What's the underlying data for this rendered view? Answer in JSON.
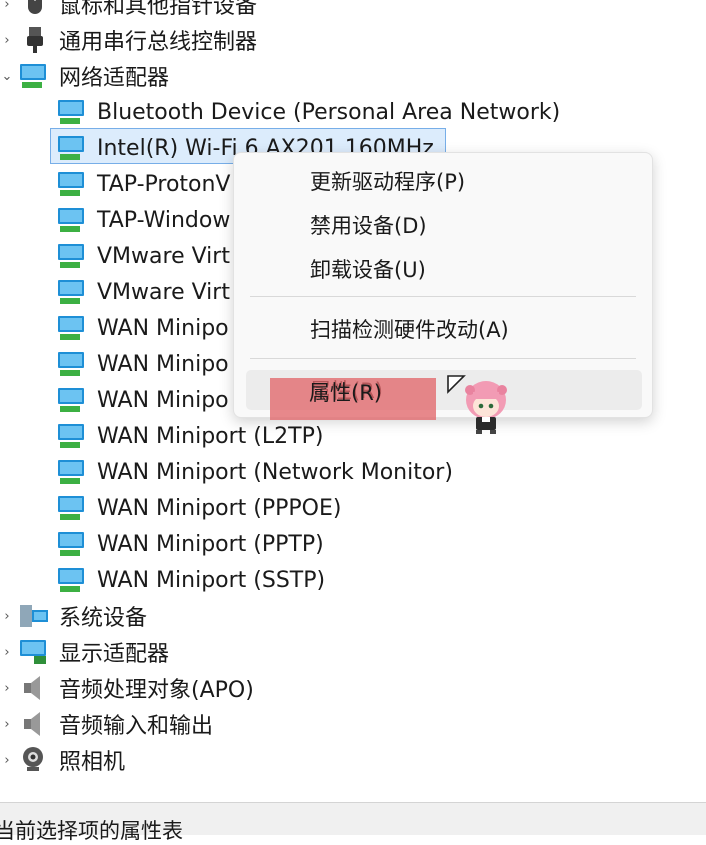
{
  "tree": {
    "categories_top": [
      {
        "label": "鼠标和其他指针设备",
        "icon": "mouse-icon"
      },
      {
        "label": "通用串行总线控制器",
        "icon": "usb-icon"
      },
      {
        "label": "网络适配器",
        "icon": "network-adapter-icon",
        "expanded": true
      }
    ],
    "network_adapters": [
      {
        "label": "Bluetooth Device (Personal Area Network)"
      },
      {
        "label": "Intel(R) Wi-Fi 6 AX201 160MHz",
        "selected": true
      },
      {
        "label": "TAP-ProtonV"
      },
      {
        "label": "TAP-Window"
      },
      {
        "label": "VMware Virt"
      },
      {
        "label": "VMware Virt"
      },
      {
        "label": "WAN Minipo"
      },
      {
        "label": "WAN Minipo"
      },
      {
        "label": "WAN Minipo"
      },
      {
        "label": "WAN Miniport (L2TP)"
      },
      {
        "label": "WAN Miniport (Network Monitor)"
      },
      {
        "label": "WAN Miniport (PPPOE)"
      },
      {
        "label": "WAN Miniport (PPTP)"
      },
      {
        "label": "WAN Miniport (SSTP)"
      }
    ],
    "categories_bottom": [
      {
        "label": "系统设备",
        "icon": "system-device-icon"
      },
      {
        "label": "显示适配器",
        "icon": "display-adapter-icon"
      },
      {
        "label": "音频处理对象(APO)",
        "icon": "speaker-icon"
      },
      {
        "label": "音频输入和输出",
        "icon": "speaker-icon"
      },
      {
        "label": "照相机",
        "icon": "camera-icon"
      }
    ]
  },
  "context_menu": {
    "items": [
      {
        "label": "更新驱动程序(P)"
      },
      {
        "label": "禁用设备(D)"
      },
      {
        "label": "卸载设备(U)"
      },
      {
        "label": "扫描检测硬件改动(A)"
      },
      {
        "label": "属性(R)",
        "hovered": true
      }
    ]
  },
  "status_bar": {
    "text": "当前选择项的属性表"
  },
  "colors": {
    "selection_bg": "#dcecfc",
    "selection_border": "#77aee8",
    "highlight_mark": "#e2686c",
    "monitor_blue": "#1e8fd6",
    "network_green": "#3cb043"
  }
}
